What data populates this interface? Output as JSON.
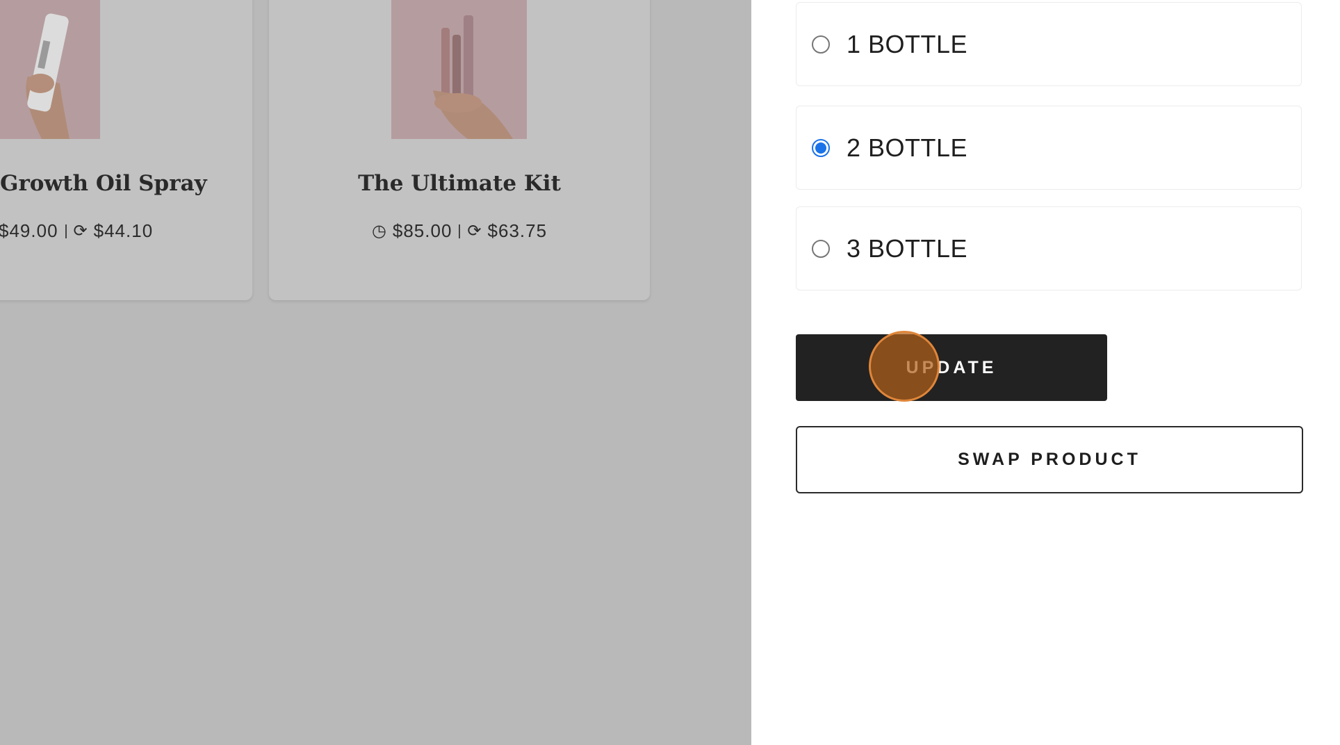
{
  "products": [
    {
      "name": "Growth Oil Spray",
      "price": "$49.00",
      "subscription_price": "$44.10"
    },
    {
      "name": "The Ultimate Kit",
      "price": "$85.00",
      "subscription_price": "$63.75"
    }
  ],
  "quantity_options": [
    {
      "label": "1 BOTTLE",
      "selected": false
    },
    {
      "label": "2 BOTTLE",
      "selected": true
    },
    {
      "label": "3 BOTTLE",
      "selected": false
    }
  ],
  "actions": {
    "update_label": "UPDATE",
    "swap_label": "SWAP PRODUCT"
  },
  "colors": {
    "radio_accent": "#1a73e8",
    "primary_button": "#222222",
    "overlay": "#b9b9b9"
  },
  "icons": {
    "one_time": "clock-icon",
    "subscription": "refresh-icon"
  }
}
